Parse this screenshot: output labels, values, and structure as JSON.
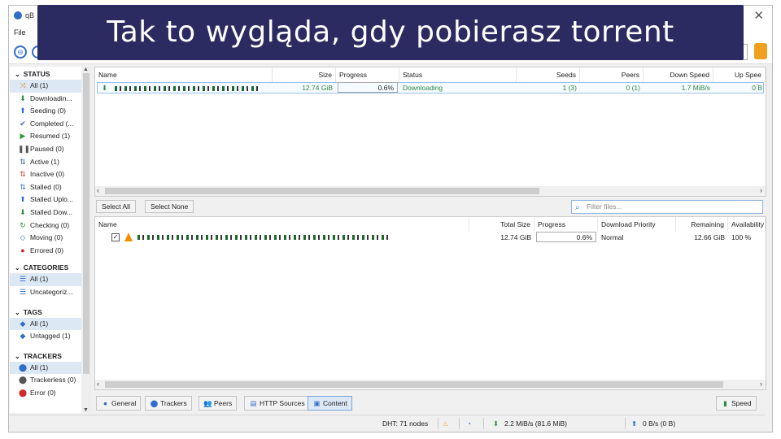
{
  "window": {
    "title_partial": "qB",
    "close_glyph": "✕"
  },
  "menu": {
    "file": "File"
  },
  "banner": {
    "text": "Tak to wygląda, gdy pobierasz torrent"
  },
  "sidebar": {
    "status_header": "STATUS",
    "status_items": [
      {
        "label": "All (1)",
        "icon": "all-status-icon",
        "glyph": "⤨",
        "color": "#e08a2a",
        "selected": true
      },
      {
        "label": "Downloadin...",
        "icon": "downloading-icon",
        "glyph": "⬇",
        "color": "#2d8a3e"
      },
      {
        "label": "Seeding (0)",
        "icon": "seeding-icon",
        "glyph": "⬆",
        "color": "#2f6dc6"
      },
      {
        "label": "Completed (...",
        "icon": "completed-icon",
        "glyph": "✔",
        "color": "#3b62b0"
      },
      {
        "label": "Resumed (1)",
        "icon": "resumed-icon",
        "glyph": "▶",
        "color": "#2d9a3e"
      },
      {
        "label": "Paused (0)",
        "icon": "paused-icon",
        "glyph": "❚❚",
        "color": "#555555"
      },
      {
        "label": "Active (1)",
        "icon": "active-icon",
        "glyph": "⇅",
        "color": "#2d5a9a"
      },
      {
        "label": "Inactive (0)",
        "icon": "inactive-icon",
        "glyph": "⇅",
        "color": "#c83a2a"
      },
      {
        "label": "Stalled (0)",
        "icon": "stalled-icon",
        "glyph": "⇅",
        "color": "#2f6dc6"
      },
      {
        "label": "Stalled Uplo...",
        "icon": "stalled-upload-icon",
        "glyph": "⬆",
        "color": "#2f6dc6"
      },
      {
        "label": "Stalled Dow...",
        "icon": "stalled-download-icon",
        "glyph": "⬇",
        "color": "#2d8a3e"
      },
      {
        "label": "Checking (0)",
        "icon": "checking-icon",
        "glyph": "↻",
        "color": "#2d8a3e"
      },
      {
        "label": "Moving (0)",
        "icon": "moving-icon",
        "glyph": "◇",
        "color": "#2f6dc6"
      },
      {
        "label": "Errored (0)",
        "icon": "errored-icon",
        "glyph": "●",
        "color": "#d02a2a"
      }
    ],
    "categories_header": "CATEGORIES",
    "category_items": [
      {
        "label": "All (1)",
        "icon": "category-list-icon",
        "glyph": "☰",
        "color": "#2f6dc6",
        "selected": true
      },
      {
        "label": "Uncategoriz...",
        "icon": "uncategorized-icon",
        "glyph": "☰",
        "color": "#2f6dc6"
      }
    ],
    "tags_header": "TAGS",
    "tag_items": [
      {
        "label": "All (1)",
        "icon": "tag-icon",
        "glyph": "◆",
        "color": "#2f6dc6",
        "selected": true
      },
      {
        "label": "Untagged (1)",
        "icon": "untagged-icon",
        "glyph": "◆",
        "color": "#2f6dc6"
      }
    ],
    "trackers_header": "TRACKERS",
    "tracker_items": [
      {
        "label": "All (1)",
        "icon": "tracker-pin-icon",
        "glyph": "⬤",
        "color": "#2f6dc6",
        "selected": true
      },
      {
        "label": "Trackerless (0)",
        "icon": "trackerless-icon",
        "glyph": "⬤",
        "color": "#555555"
      },
      {
        "label": "Error (0)",
        "icon": "tracker-error-icon",
        "glyph": "⬤",
        "color": "#d02a2a"
      }
    ]
  },
  "torrent_table": {
    "columns": [
      "Name",
      "Size",
      "Progress",
      "Status",
      "Seeds",
      "Peers",
      "Down Speed",
      "Up Spee"
    ],
    "row": {
      "size": "12.74 GiB",
      "progress": "0.6%",
      "status": "Downloading",
      "seeds": "1 (3)",
      "peers": "0 (1)",
      "down_speed": "1.7 MiB/s",
      "up_speed": "0 B"
    }
  },
  "content_toolbar": {
    "select_all": "Select All",
    "select_none": "Select None",
    "filter_placeholder": "Filter files..."
  },
  "content_table": {
    "columns": [
      "Name",
      "Total Size",
      "Progress",
      "Download Priority",
      "Remaining",
      "Availability"
    ],
    "row": {
      "checked": "✓",
      "total_size": "12.74 GiB",
      "progress": "0.6%",
      "priority": "Normal",
      "remaining": "12.66 GiB",
      "availability": "100 %"
    }
  },
  "bottom_tabs": {
    "general": "General",
    "trackers": "Trackers",
    "peers": "Peers",
    "http_sources": "HTTP Sources",
    "content": "Content",
    "speed": "Speed"
  },
  "statusbar": {
    "dht": "DHT: 71 nodes",
    "download": "2.2 MiB/s (81.6 MiB)",
    "upload": "0 B/s (0 B)"
  }
}
